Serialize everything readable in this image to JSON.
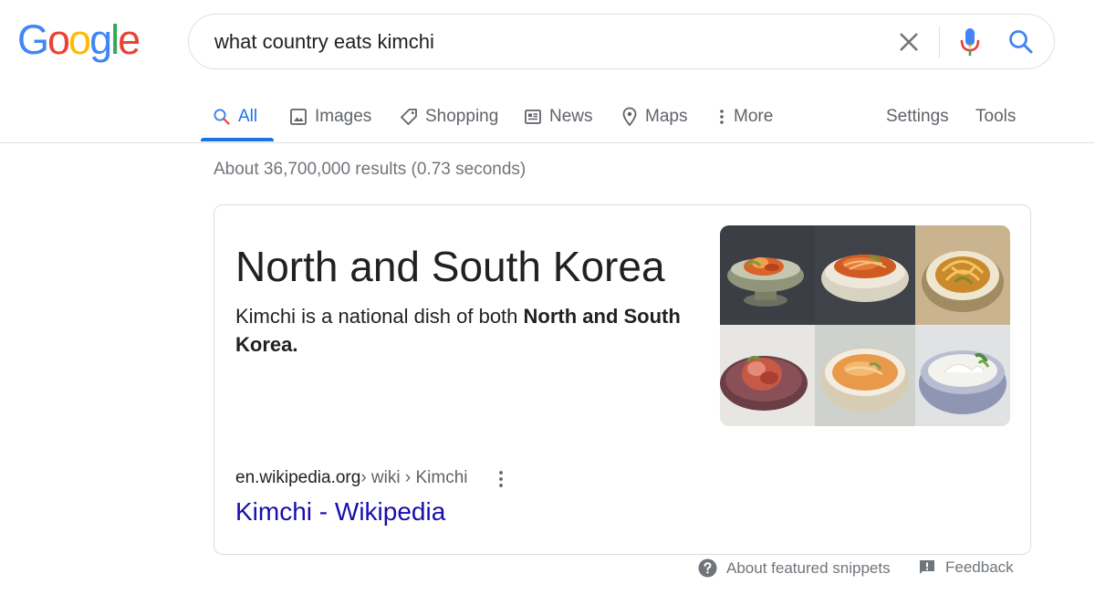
{
  "logo": {
    "letters": [
      {
        "char": "G",
        "color": "#4285f4"
      },
      {
        "char": "o",
        "color": "#ea4335"
      },
      {
        "char": "o",
        "color": "#fbbc05"
      },
      {
        "char": "g",
        "color": "#4285f4"
      },
      {
        "char": "l",
        "color": "#34a853"
      },
      {
        "char": "e",
        "color": "#ea4335"
      }
    ]
  },
  "search": {
    "value": "what country eats kimchi",
    "clear_icon": "close-icon",
    "mic_icon": "mic-icon",
    "search_icon": "search-icon"
  },
  "tabs": [
    {
      "label": "All",
      "icon": "search-icon",
      "active": true
    },
    {
      "label": "Images",
      "icon": "image-icon",
      "active": false
    },
    {
      "label": "Shopping",
      "icon": "tag-icon",
      "active": false
    },
    {
      "label": "News",
      "icon": "newspaper-icon",
      "active": false
    },
    {
      "label": "Maps",
      "icon": "map-pin-icon",
      "active": false
    },
    {
      "label": "More",
      "icon": "vertical-dots-icon",
      "active": false
    }
  ],
  "tools": {
    "settings": "Settings",
    "tools": "Tools"
  },
  "stats": "About 36,700,000 results (0.73 seconds)",
  "featured": {
    "answer": "North and South Korea",
    "snippet_prefix": "Kimchi is a national dish of both ",
    "snippet_bold": "North and South Korea.",
    "source_domain": "en.wikipedia.org",
    "source_path": " › wiki › Kimchi",
    "result_title": "Kimchi - Wikipedia"
  },
  "footer": {
    "about": "About featured snippets",
    "feedback": "Feedback"
  },
  "colors": {
    "accent": "#1a73e8",
    "link": "#1a0dab",
    "muted": "#70757a"
  }
}
